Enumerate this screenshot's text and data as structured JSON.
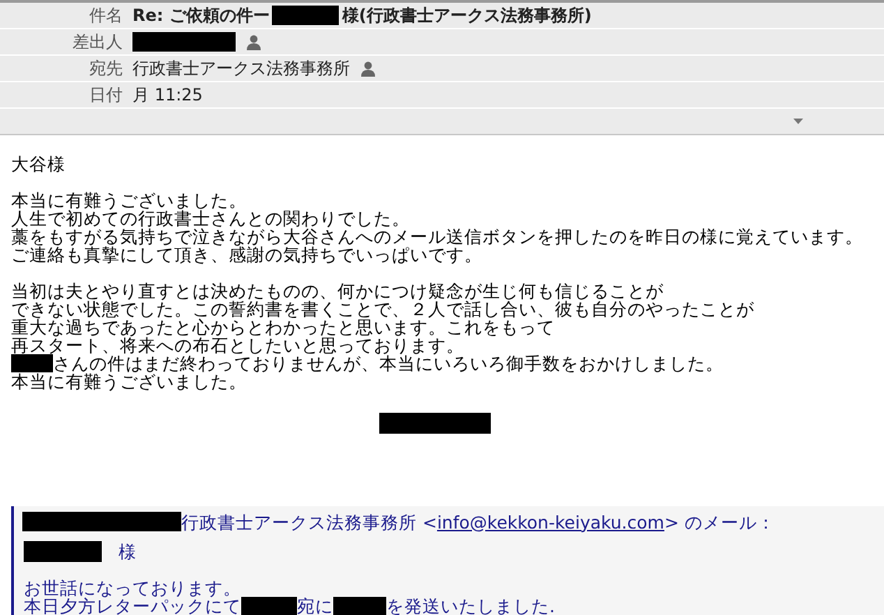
{
  "header": {
    "fields": [
      {
        "label": "件名",
        "kind": "subject",
        "parts": [
          {
            "kind": "text",
            "text": "Re: ご依頼の件ー"
          },
          {
            "kind": "redacted"
          },
          {
            "kind": "text",
            "text": "様(行政書士アークス法務事務所)"
          }
        ]
      },
      {
        "label": "差出人",
        "kind": "person",
        "parts": [
          {
            "kind": "redacted"
          }
        ]
      },
      {
        "label": "宛先",
        "kind": "person",
        "parts": [
          {
            "kind": "text",
            "text": "行政書士アークス法務事務所"
          }
        ]
      },
      {
        "label": "日付",
        "kind": "plain",
        "parts": [
          {
            "kind": "text",
            "text": "月 11:25"
          }
        ]
      }
    ]
  },
  "body": {
    "lines": [
      {
        "kind": "text",
        "parts": [
          {
            "kind": "text",
            "text": "大谷様"
          }
        ]
      },
      {
        "kind": "blank"
      },
      {
        "kind": "text",
        "parts": [
          {
            "kind": "text",
            "text": "本当に有難うございました。"
          }
        ]
      },
      {
        "kind": "text",
        "parts": [
          {
            "kind": "text",
            "text": "人生で初めての行政書士さんとの関わりでした。"
          }
        ]
      },
      {
        "kind": "text",
        "parts": [
          {
            "kind": "text",
            "text": "藁をもすがる気持ちで泣きながら大谷さんへのメール送信ボタンを押したのを昨日の様に覚えています。"
          }
        ]
      },
      {
        "kind": "text",
        "parts": [
          {
            "kind": "text",
            "text": "ご連絡も真摯にして頂き、感謝の気持ちでいっぱいです。"
          }
        ]
      },
      {
        "kind": "blank"
      },
      {
        "kind": "text",
        "parts": [
          {
            "kind": "text",
            "text": "当初は夫とやり直すとは決めたものの、何かにつけ疑念が生じ何も信じることが"
          }
        ]
      },
      {
        "kind": "text",
        "parts": [
          {
            "kind": "text",
            "text": "できない状態でした。この誓約書を書くことで、２人で話し合い、彼も自分のやったことが"
          }
        ]
      },
      {
        "kind": "text",
        "parts": [
          {
            "kind": "text",
            "text": "重大な過ちであったと心からとわかったと思います。これをもって"
          }
        ]
      },
      {
        "kind": "text",
        "parts": [
          {
            "kind": "text",
            "text": "再スタート、将来への布石としたいと思っております。"
          }
        ]
      },
      {
        "kind": "text",
        "parts": [
          {
            "kind": "redacted"
          },
          {
            "kind": "text",
            "text": "さんの件はまだ終わっておりませんが、本当にいろいろ御手数をおかけしました。"
          }
        ]
      },
      {
        "kind": "text",
        "parts": [
          {
            "kind": "text",
            "text": "本当に有難うございました。"
          }
        ]
      }
    ]
  },
  "quote": {
    "intro": [
      {
        "kind": "redacted"
      },
      {
        "kind": "text",
        "text": "行政書士アークス法務事務所 <"
      },
      {
        "kind": "link",
        "text": "info@kekkon-keiyaku.com"
      },
      {
        "kind": "text",
        "text": "> のメール："
      }
    ],
    "lines": [
      {
        "kind": "text",
        "parts": [
          {
            "kind": "redacted"
          },
          {
            "kind": "text",
            "text": "様"
          }
        ]
      },
      {
        "kind": "blank"
      },
      {
        "kind": "text",
        "parts": [
          {
            "kind": "text",
            "text": "お世話になっております。"
          }
        ]
      },
      {
        "kind": "text",
        "parts": [
          {
            "kind": "text",
            "text": "本日夕方レターパックにて"
          },
          {
            "kind": "redacted"
          },
          {
            "kind": "text",
            "text": "宛に"
          },
          {
            "kind": "redacted"
          },
          {
            "kind": "text",
            "text": "を発送いたしました."
          }
        ]
      }
    ]
  }
}
